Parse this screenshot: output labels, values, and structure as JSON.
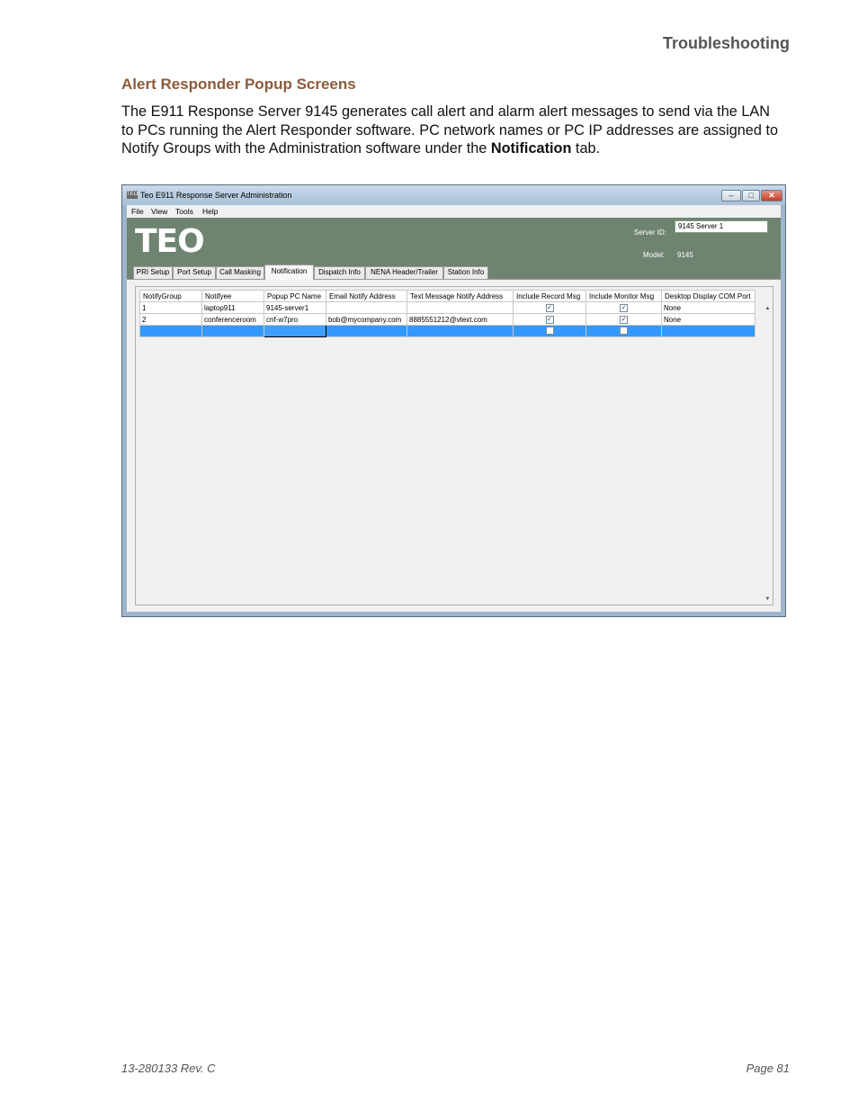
{
  "page": {
    "header": "Troubleshooting",
    "section_title": "Alert Responder Popup Screens",
    "paragraph_before_bold": "The E911 Response Server 9145 generates call alert and alarm alert messages to send via the LAN to PCs running the Alert Responder software. PC network names or PC IP addresses are assigned to Notify Groups with the Administration software under the ",
    "paragraph_bold": "Notification",
    "paragraph_after_bold": " tab.",
    "footer_left": "13-280133  Rev. C",
    "footer_right": "Page 81"
  },
  "window": {
    "title": "Teo E911 Response Server Administration",
    "icon_text": "TEO",
    "menus": [
      "File",
      "View",
      "Tools",
      "Help"
    ],
    "logo": "TEO",
    "server_id_label": "Server ID:",
    "server_id_value": "9145 Server 1",
    "model_label": "Model:",
    "model_value": "9145",
    "tabs": [
      "PRI Setup",
      "Port Setup",
      "Call Masking",
      "Notification",
      "Dispatch Info",
      "NENA Header/Trailer",
      "Station Info"
    ],
    "active_tab": "Notification",
    "grid": {
      "columns": [
        "NotifyGroup",
        "Notifyee",
        "Popup PC Name",
        "Email Notify Address",
        "Text Message Notify Address",
        "Include Record Msg",
        "Include Monitor Msg",
        "Desktop Display COM Port"
      ],
      "rows": [
        {
          "group": "1",
          "notifyee": "laptop911",
          "pc": "9145-server1",
          "email": "",
          "text": "",
          "record": true,
          "monitor": true,
          "com": "None"
        },
        {
          "group": "2",
          "notifyee": "conferenceroom",
          "pc": "cnf-w7pro",
          "email": "bob@mycompany.com",
          "text": "8885551212@vtext.com",
          "record": true,
          "monitor": true,
          "com": "None"
        },
        {
          "group": "",
          "notifyee": "",
          "pc": "",
          "email": "",
          "text": "",
          "record": false,
          "monitor": false,
          "com": ""
        }
      ]
    }
  }
}
